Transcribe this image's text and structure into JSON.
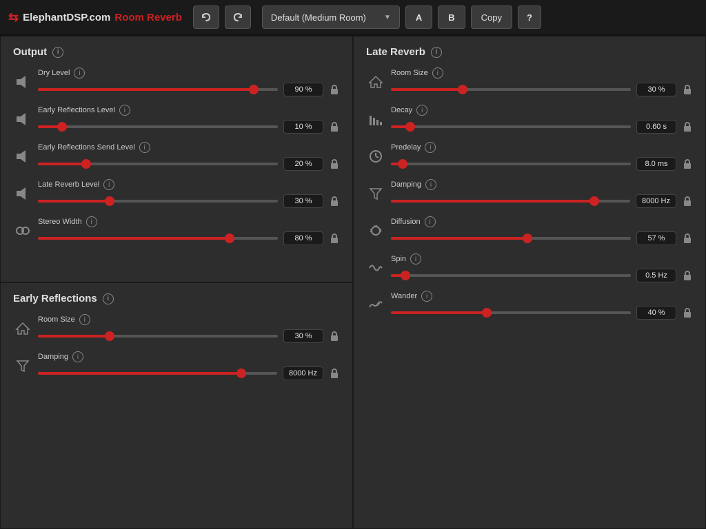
{
  "app": {
    "logo_arrows": "⇆",
    "brand": "ElephantDSP.com",
    "product": "Room Reverb"
  },
  "topbar": {
    "undo_label": "↩",
    "redo_label": "↪",
    "preset_name": "Default (Medium Room)",
    "btn_a": "A",
    "btn_b": "B",
    "btn_copy": "Copy",
    "btn_help": "?"
  },
  "output": {
    "title": "Output",
    "sliders": [
      {
        "id": "dry-level",
        "label": "Dry Level",
        "value": "90 %",
        "fill_pct": 90,
        "thumb_pct": 90,
        "locked": false,
        "icon": "volume"
      },
      {
        "id": "early-reflections-level",
        "label": "Early Reflections Level",
        "value": "10 %",
        "fill_pct": 10,
        "thumb_pct": 10,
        "locked": false,
        "icon": "volume"
      },
      {
        "id": "early-reflections-send-level",
        "label": "Early Reflections Send Level",
        "value": "20 %",
        "fill_pct": 20,
        "thumb_pct": 20,
        "locked": false,
        "icon": "volume"
      },
      {
        "id": "late-reverb-level",
        "label": "Late Reverb Level",
        "value": "30 %",
        "fill_pct": 30,
        "thumb_pct": 30,
        "locked": false,
        "icon": "volume"
      },
      {
        "id": "stereo-width",
        "label": "Stereo Width",
        "value": "80 %",
        "fill_pct": 80,
        "thumb_pct": 80,
        "locked": false,
        "icon": "stereo"
      }
    ]
  },
  "early_reflections": {
    "title": "Early Reflections",
    "sliders": [
      {
        "id": "er-room-size",
        "label": "Room Size",
        "value": "30 %",
        "fill_pct": 30,
        "thumb_pct": 30,
        "locked": false,
        "icon": "house"
      },
      {
        "id": "er-damping",
        "label": "Damping",
        "value": "8000 Hz",
        "fill_pct": 85,
        "thumb_pct": 85,
        "locked": false,
        "icon": "filter"
      }
    ]
  },
  "late_reverb": {
    "title": "Late Reverb",
    "sliders": [
      {
        "id": "lr-room-size",
        "label": "Room Size",
        "value": "30 %",
        "fill_pct": 30,
        "thumb_pct": 30,
        "locked": false,
        "icon": "house"
      },
      {
        "id": "lr-decay",
        "label": "Decay",
        "value": "0.60 s",
        "fill_pct": 8,
        "thumb_pct": 8,
        "locked": false,
        "icon": "bars"
      },
      {
        "id": "lr-predelay",
        "label": "Predelay",
        "value": "8.0 ms",
        "fill_pct": 5,
        "thumb_pct": 5,
        "locked": false,
        "icon": "clock"
      },
      {
        "id": "lr-damping",
        "label": "Damping",
        "value": "8000 Hz",
        "fill_pct": 85,
        "thumb_pct": 85,
        "locked": false,
        "icon": "filter"
      },
      {
        "id": "lr-diffusion",
        "label": "Diffusion",
        "value": "57 %",
        "fill_pct": 57,
        "thumb_pct": 57,
        "locked": false,
        "icon": "diffusion"
      },
      {
        "id": "lr-spin",
        "label": "Spin",
        "value": "0.5 Hz",
        "fill_pct": 6,
        "thumb_pct": 6,
        "locked": false,
        "icon": "sine"
      },
      {
        "id": "lr-wander",
        "label": "Wander",
        "value": "40 %",
        "fill_pct": 40,
        "thumb_pct": 40,
        "locked": false,
        "icon": "wander"
      }
    ]
  }
}
